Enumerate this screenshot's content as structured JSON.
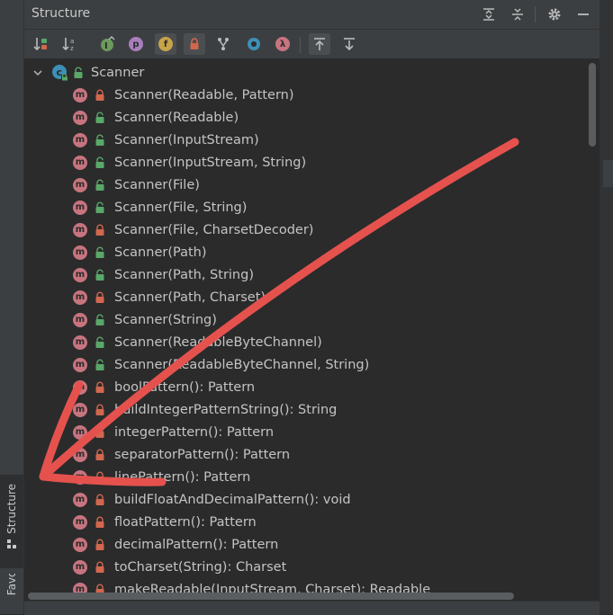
{
  "side_tabs": {
    "structure": "Structure",
    "favorites": "Favorites"
  },
  "header": {
    "title": "Structure"
  },
  "tree": {
    "root": {
      "label": "Scanner"
    },
    "items": [
      {
        "label": "Scanner(Readable, Pattern)",
        "access": "private"
      },
      {
        "label": "Scanner(Readable)",
        "access": "public"
      },
      {
        "label": "Scanner(InputStream)",
        "access": "public"
      },
      {
        "label": "Scanner(InputStream, String)",
        "access": "public"
      },
      {
        "label": "Scanner(File)",
        "access": "public"
      },
      {
        "label": "Scanner(File, String)",
        "access": "public"
      },
      {
        "label": "Scanner(File, CharsetDecoder)",
        "access": "private"
      },
      {
        "label": "Scanner(Path)",
        "access": "public"
      },
      {
        "label": "Scanner(Path, String)",
        "access": "public"
      },
      {
        "label": "Scanner(Path, Charset)",
        "access": "private"
      },
      {
        "label": "Scanner(String)",
        "access": "public"
      },
      {
        "label": "Scanner(ReadableByteChannel)",
        "access": "public"
      },
      {
        "label": "Scanner(ReadableByteChannel, String)",
        "access": "public"
      },
      {
        "label": "boolPattern(): Pattern",
        "access": "private"
      },
      {
        "label": "buildIntegerPatternString(): String",
        "access": "private"
      },
      {
        "label": "integerPattern(): Pattern",
        "access": "private"
      },
      {
        "label": "separatorPattern(): Pattern",
        "access": "private"
      },
      {
        "label": "linePattern(): Pattern",
        "access": "private"
      },
      {
        "label": "buildFloatAndDecimalPattern(): void",
        "access": "private"
      },
      {
        "label": "floatPattern(): Pattern",
        "access": "private"
      },
      {
        "label": "decimalPattern(): Pattern",
        "access": "private"
      },
      {
        "label": "toCharset(String): Charset",
        "access": "private"
      },
      {
        "label": "makeReadable(InputStream, Charset): Readable",
        "access": "private"
      }
    ]
  },
  "icons": {
    "method_letter": "m",
    "properties_letter": "p",
    "fields_letter": "f",
    "lambda_letter": "λ",
    "method_color": "#c7747f",
    "private_lock_color": "#d1674e",
    "public_lock_color": "#59a869",
    "annotation_arrow_color": "#e5524e"
  }
}
